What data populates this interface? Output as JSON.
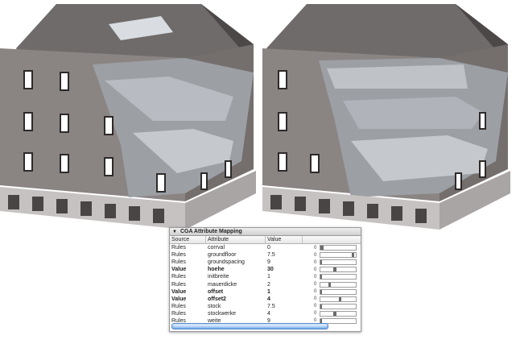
{
  "panel": {
    "title": "CGA Attribute Mapping",
    "columns": [
      "Source",
      "Attribute",
      "Value"
    ],
    "rows": [
      {
        "source": "Rules",
        "attribute": "corrval",
        "value": "0",
        "zero": "0",
        "level": 0.05,
        "bold": false
      },
      {
        "source": "Rules",
        "attribute": "groundfloor",
        "value": "7.5",
        "zero": "0",
        "level": 0.97,
        "bold": false
      },
      {
        "source": "Rules",
        "attribute": "groundspacing",
        "value": "9",
        "zero": "0",
        "level": 0.0,
        "bold": false
      },
      {
        "source": "Value",
        "attribute": "hoehe",
        "value": "30",
        "zero": "0",
        "level": 0.45,
        "bold": true
      },
      {
        "source": "Rules",
        "attribute": "initbreite",
        "value": "1",
        "zero": "0",
        "level": 0.0,
        "bold": false
      },
      {
        "source": "Rules",
        "attribute": "mauerdicke",
        "value": "2",
        "zero": "0",
        "level": 0.3,
        "bold": false
      },
      {
        "source": "Value",
        "attribute": "offset",
        "value": "1",
        "zero": "0",
        "level": 0.0,
        "bold": true
      },
      {
        "source": "Value",
        "attribute": "offset2",
        "value": "4",
        "zero": "0",
        "level": 0.6,
        "bold": true
      },
      {
        "source": "Rules",
        "attribute": "stock",
        "value": "7.5",
        "zero": "0",
        "level": 0.0,
        "bold": false
      },
      {
        "source": "Rules",
        "attribute": "stockwerke",
        "value": "4",
        "zero": "0",
        "level": 0.45,
        "bold": false
      },
      {
        "source": "Rules",
        "attribute": "weite",
        "value": "9",
        "zero": "0",
        "level": 0.0,
        "bold": false
      }
    ]
  },
  "colors": {
    "wall": "#8a8483",
    "wall_dark": "#5c5556",
    "roof": "#6f6b6a",
    "window": "#ffffff",
    "slider_fill": "#6b6b6b",
    "scroll": "#6ea5e6"
  }
}
